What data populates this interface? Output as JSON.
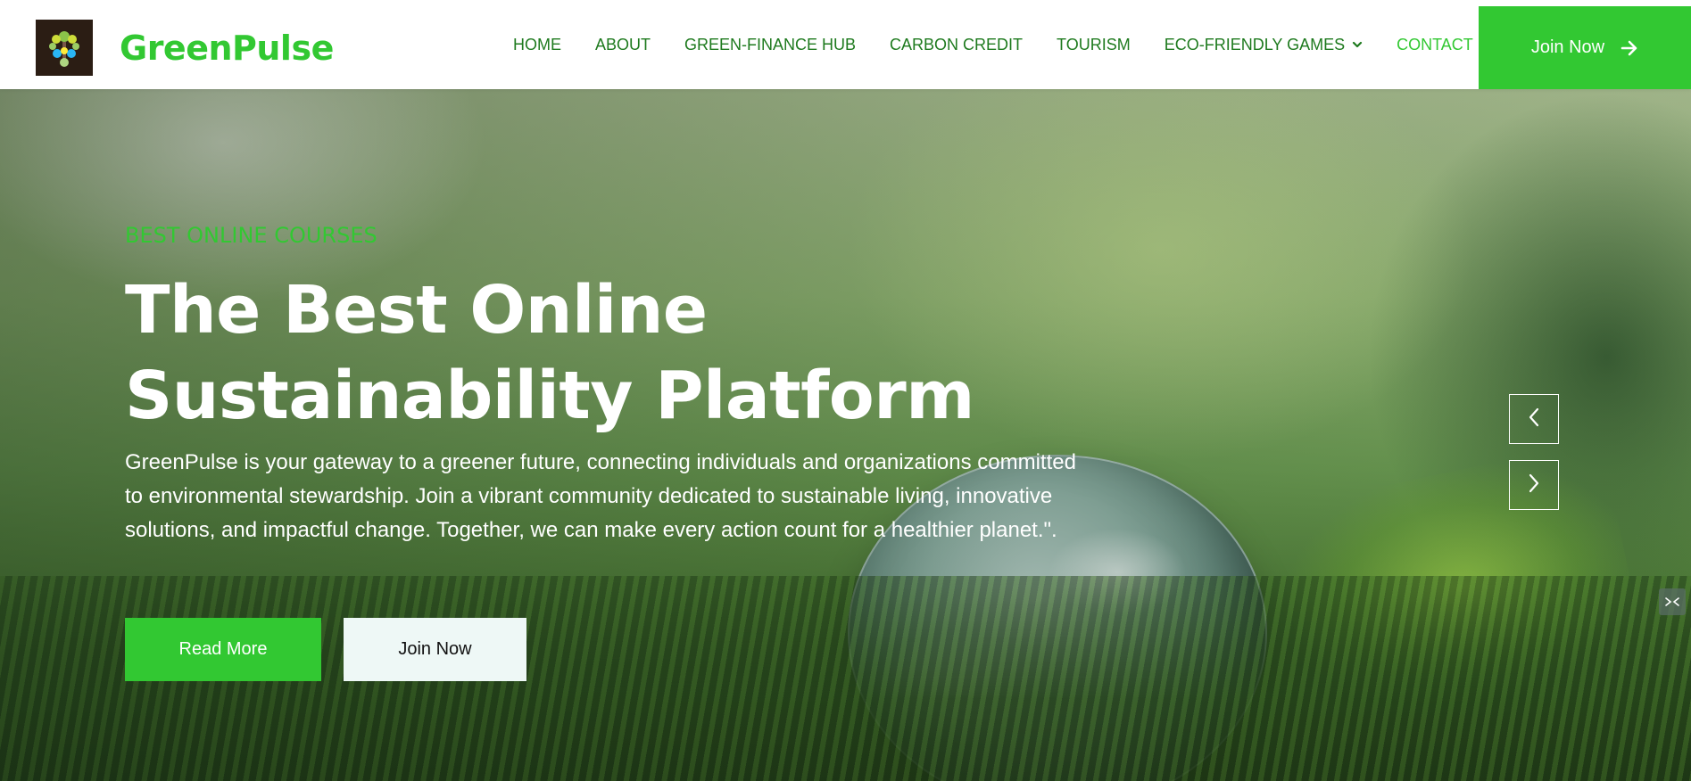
{
  "brand": {
    "name": "GreenPulse",
    "logo_icon": "tree-logo-icon"
  },
  "nav": {
    "items": [
      {
        "label": "HOME"
      },
      {
        "label": "ABOUT"
      },
      {
        "label": "GREEN-FINANCE HUB"
      },
      {
        "label": "CARBON CREDIT"
      },
      {
        "label": "TOURISM"
      },
      {
        "label": "ECO-FRIENDLY GAMES",
        "icon": "chevron-down-icon"
      },
      {
        "label": "CONTACT",
        "active": true
      }
    ],
    "cta_label": "Join Now",
    "cta_icon": "arrow-right-icon"
  },
  "hero": {
    "eyebrow": "BEST ONLINE COURSES",
    "headline_line1": "The Best Online",
    "headline_line2": "Sustainability Platform",
    "description": "GreenPulse is your gateway to a greener future, connecting individuals and organizations committed to environmental stewardship. Join a vibrant community dedicated to sustainable living, innovative solutions, and impactful change. Together, we can make every action count for a healthier planet.\".",
    "primary_button": "Read More",
    "secondary_button": "Join Now",
    "prev_icon": "chevron-left-icon",
    "next_icon": "chevron-right-icon"
  },
  "colors": {
    "brand_green": "#32c832",
    "nav_text": "#1e7a1e",
    "secondary_button_bg": "#eef8f6"
  }
}
